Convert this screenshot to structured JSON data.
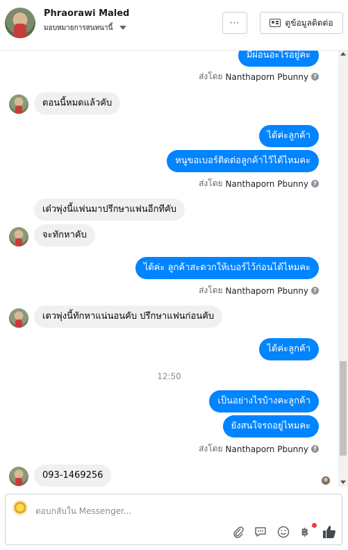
{
  "header": {
    "name": "Phraorawi Maled",
    "assign_label": "มอบหมายการสนทนานี้",
    "more_label": "···",
    "contact_label": "ดูข้อมูลติดต่อ"
  },
  "messages": {
    "m0": "มีผ่อนอะไรอยู่คะ",
    "s0_prefix": "ส่งโดย",
    "s0_name": "Nanthaporn Pbunny",
    "m1": "ตอนนี้หมดแล้วคับ",
    "m2": "ได้ค่ะลูกค้า",
    "m3": "หนูขอเบอร์ติดต่อลูกค้าไว้ได้ไหมคะ",
    "s1_prefix": "ส่งโดย",
    "s1_name": "Nanthaporn Pbunny",
    "m4": "เด๋วพุ่งนี้แฟนมาปรึกษาแฟนอีกทีคับ",
    "m5": "จะทักหาคับ",
    "m6": "ได้ค่ะ ลูกค้าสะดวกให้เบอร์ไว้ก่อนได้ไหมคะ",
    "s2_prefix": "ส่งโดย",
    "s2_name": "Nanthaporn Pbunny",
    "m7": "เดวพุ่งนี้ทักหาแน่นอนคับ ปรึกษาแฟนก่อนคับ",
    "m8": "ได้ค่ะลูกค้า",
    "time": "12:50",
    "m9": "เป็นอย่างไรบ้างคะลูกค้า",
    "m10": "ยังสนใจรถอยู่ไหมคะ",
    "s3_prefix": "ส่งโดย",
    "s3_name": "Nanthaporn Pbunny",
    "m11": "093-1469256"
  },
  "composer": {
    "placeholder": "ตอบกลับใน Messenger...",
    "baht_symbol": "฿"
  },
  "colors": {
    "outgoing_bubble": "#0084ff",
    "incoming_bubble": "#f0f0f0",
    "notification_dot": "#fa383e"
  },
  "icons": [
    "more-icon",
    "contact-card-icon",
    "caret-down-icon",
    "info-icon",
    "attachment-icon",
    "saved-reply-icon",
    "emoji-icon",
    "baht-icon",
    "thumbs-up-icon"
  ]
}
